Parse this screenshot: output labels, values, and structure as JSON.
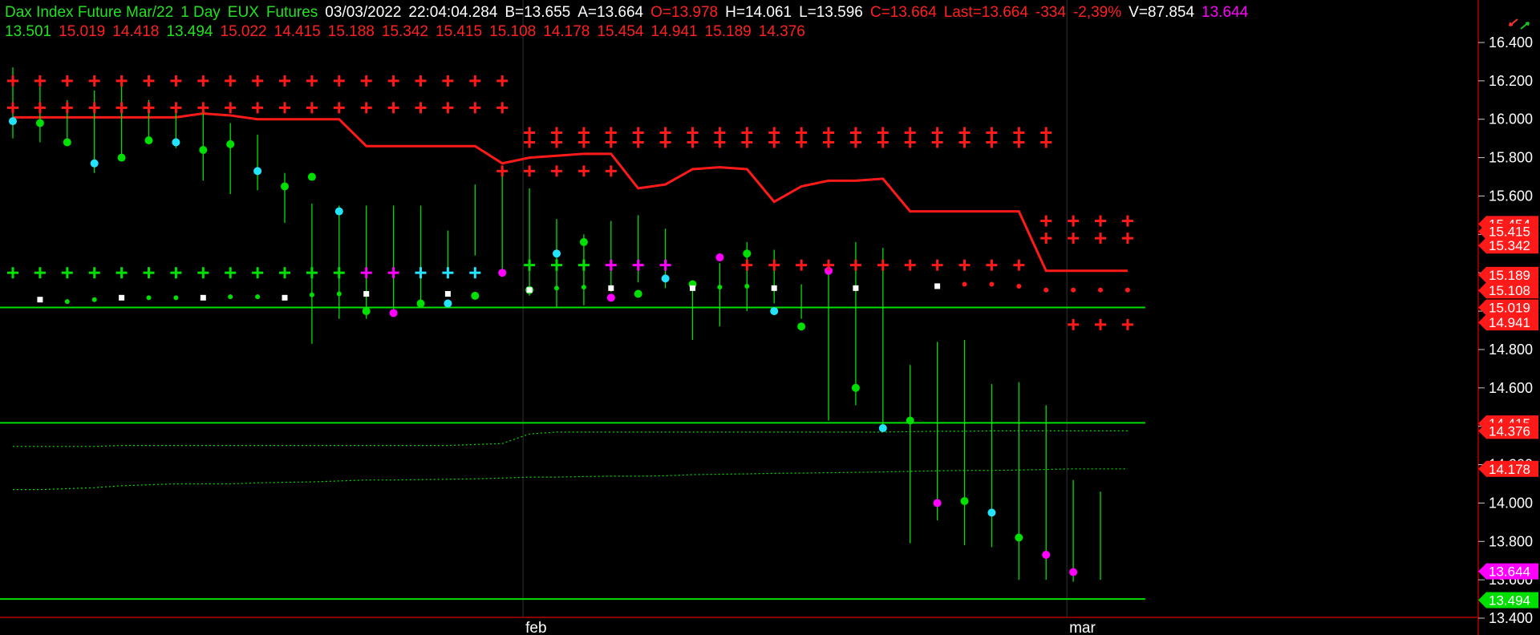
{
  "header": {
    "line1": [
      {
        "text": "Dax Index Future Mar/22",
        "color": "#22e022"
      },
      {
        "text": "1 Day",
        "color": "#22e022"
      },
      {
        "text": "EUX",
        "color": "#22e022"
      },
      {
        "text": "Futures",
        "color": "#22e022"
      },
      {
        "text": "03/03/2022",
        "color": "#ffffff"
      },
      {
        "text": "22:04:04.284",
        "color": "#ffffff"
      },
      {
        "text": "B=13.655",
        "color": "#ffffff"
      },
      {
        "text": "A=13.664",
        "color": "#ffffff"
      },
      {
        "text": "O=13.978",
        "color": "#ff2020"
      },
      {
        "text": "H=14.061",
        "color": "#ffffff"
      },
      {
        "text": "L=13.596",
        "color": "#ffffff"
      },
      {
        "text": "C=13.664",
        "color": "#ff2020"
      },
      {
        "text": "Last=13.664",
        "color": "#ff2020"
      },
      {
        "text": "-334",
        "color": "#ff2020"
      },
      {
        "text": "-2,39%",
        "color": "#ff2020"
      },
      {
        "text": "V=87.854",
        "color": "#ffffff"
      },
      {
        "text": "13.644",
        "color": "#ff00ff"
      }
    ],
    "line2": [
      {
        "text": "13.501",
        "color": "#22e022"
      },
      {
        "text": "15.019",
        "color": "#ff2020"
      },
      {
        "text": "14.418",
        "color": "#ff2020"
      },
      {
        "text": "13.494",
        "color": "#22e022"
      },
      {
        "text": "15.022",
        "color": "#ff2020"
      },
      {
        "text": "14.415",
        "color": "#ff2020"
      },
      {
        "text": "15.188",
        "color": "#ff2020"
      },
      {
        "text": "15.342",
        "color": "#ff2020"
      },
      {
        "text": "15.415",
        "color": "#ff2020"
      },
      {
        "text": "15.108",
        "color": "#ff2020"
      },
      {
        "text": "14.178",
        "color": "#ff2020"
      },
      {
        "text": "15.454",
        "color": "#ff2020"
      },
      {
        "text": "14.941",
        "color": "#ff2020"
      },
      {
        "text": "15.189",
        "color": "#ff2020"
      },
      {
        "text": "14.376",
        "color": "#ff2020"
      }
    ]
  },
  "colors": {
    "background": "#000000",
    "green": "#00e000",
    "red": "#ff1a1a",
    "cyan": "#22e4ff",
    "magenta": "#ff00ff",
    "white": "#ffffff",
    "axis": "#c8c8c8",
    "grid": "#333333"
  },
  "chart_data": {
    "type": "line",
    "title": "Dax Index Future Mar/22",
    "ylim": [
      13400,
      16500
    ],
    "y_ticks": [
      16400,
      16200,
      16000,
      15800,
      15600,
      15400,
      15200,
      15000,
      14800,
      14600,
      14400,
      14200,
      14000,
      13800,
      13600,
      13400
    ],
    "y_tick_labels": [
      "16.400",
      "16.200",
      "16.000",
      "15.800",
      "15.600",
      "15.400",
      "15.200",
      "15.000",
      "14.800",
      "14.600",
      "14.400",
      "14.200",
      "14.000",
      "13.800",
      "13.600",
      "13.400"
    ],
    "x_month_labels": [
      {
        "bar": 19,
        "label": "feb"
      },
      {
        "bar": 39,
        "label": "mar"
      }
    ],
    "grid": true,
    "price_bars": {
      "high": [
        16270,
        16170,
        16100,
        16150,
        16180,
        16100,
        16030,
        16030,
        15980,
        15920,
        15720,
        15560,
        15550,
        15550,
        15550,
        15550,
        15420,
        15660,
        15710,
        15640,
        15480,
        15400,
        15470,
        15500,
        15430,
        15130,
        15250,
        15360,
        15320,
        15140,
        15210,
        15360,
        15330,
        14720,
        14840,
        14850,
        14620,
        14630,
        14510,
        14120,
        14060
      ],
      "low": [
        15900,
        15880,
        15860,
        15720,
        15790,
        15900,
        15850,
        15680,
        15610,
        15630,
        15460,
        14830,
        14960,
        14960,
        15000,
        15030,
        15170,
        15290,
        15220,
        15080,
        15020,
        15030,
        15100,
        15150,
        15120,
        14850,
        14920,
        15000,
        15040,
        14960,
        14430,
        14510,
        14380,
        13790,
        13910,
        13780,
        13770,
        13600,
        13600,
        13590,
        13600
      ],
      "marker": [
        15990,
        15980,
        15880,
        15770,
        15800,
        15890,
        15880,
        15840,
        15870,
        15730,
        15650,
        15700,
        15520,
        15000,
        14990,
        15040,
        15040,
        15080,
        15200,
        15110,
        15300,
        15360,
        15070,
        15090,
        15170,
        15140,
        15280,
        15300,
        15000,
        14920,
        15210,
        14600,
        14390,
        14430,
        14000,
        14010,
        13950,
        13820,
        13730,
        13640
      ]
    },
    "series": [
      {
        "name": "13.501",
        "color": "#00e000",
        "style": "flat",
        "values": [
          {
            "from": 0,
            "to": 42,
            "y": 13500
          }
        ]
      },
      {
        "name": "14.418",
        "color": "#00e000",
        "style": "flat",
        "values": [
          {
            "from": 0,
            "to": 42,
            "y": 14418
          }
        ]
      },
      {
        "name": "15.019",
        "color": "#00e000",
        "style": "flat",
        "values": [
          {
            "from": 0,
            "to": 42,
            "y": 15019
          }
        ]
      },
      {
        "name": "14.376",
        "color": "#00e000",
        "style": "dotted",
        "values": [
          14295,
          14295,
          14295,
          14295,
          14300,
          14300,
          14300,
          14300,
          14300,
          14300,
          14300,
          14300,
          14300,
          14300,
          14300,
          14300,
          14300,
          14305,
          14310,
          14360,
          14370,
          14370,
          14370,
          14370,
          14370,
          14370,
          14370,
          14370,
          14370,
          14370,
          14370,
          14370,
          14370,
          14372,
          14374,
          14374,
          14376,
          14376,
          14376,
          14376,
          14376,
          14376
        ]
      },
      {
        "name": "14.178",
        "color": "#00e000",
        "style": "dotted",
        "values": [
          14070,
          14070,
          14075,
          14080,
          14090,
          14095,
          14100,
          14100,
          14100,
          14105,
          14108,
          14110,
          14115,
          14120,
          14120,
          14122,
          14124,
          14126,
          14130,
          14135,
          14135,
          14138,
          14140,
          14140,
          14142,
          14148,
          14150,
          14152,
          14155,
          14156,
          14158,
          14160,
          14162,
          14165,
          14168,
          14170,
          14170,
          14172,
          14175,
          14178,
          14178,
          14178
        ]
      },
      {
        "name": "stop",
        "color": "#ff1a1a",
        "style": "line",
        "values": [
          16010,
          16010,
          16010,
          16010,
          16010,
          16010,
          16010,
          16030,
          16020,
          16000,
          16000,
          16000,
          16000,
          15860,
          15860,
          15860,
          15860,
          15860,
          15770,
          15800,
          15810,
          15820,
          15820,
          15640,
          15660,
          15740,
          15750,
          15740,
          15570,
          15650,
          15680,
          15680,
          15690,
          15520,
          15520,
          15520,
          15520,
          15520,
          15210,
          15210,
          15210,
          15210
        ]
      },
      {
        "name": "white dots",
        "color": "#ffffff",
        "style": "points",
        "values": [
          {
            "bar": 1,
            "y": 15060
          },
          {
            "bar": 4,
            "y": 15070
          },
          {
            "bar": 7,
            "y": 15070
          },
          {
            "bar": 10,
            "y": 15070
          },
          {
            "bar": 13,
            "y": 15090
          },
          {
            "bar": 16,
            "y": 15090
          },
          {
            "bar": 19,
            "y": 15110
          },
          {
            "bar": 22,
            "y": 15120
          },
          {
            "bar": 25,
            "y": 15120
          },
          {
            "bar": 28,
            "y": 15120
          },
          {
            "bar": 31,
            "y": 15120
          },
          {
            "bar": 34,
            "y": 15130
          }
        ]
      },
      {
        "name": "green dots",
        "color": "#00e000",
        "style": "points",
        "values": [
          {
            "bar": 2,
            "y": 15050
          },
          {
            "bar": 3,
            "y": 15060
          },
          {
            "bar": 5,
            "y": 15070
          },
          {
            "bar": 6,
            "y": 15070
          },
          {
            "bar": 8,
            "y": 15075
          },
          {
            "bar": 9,
            "y": 15075
          },
          {
            "bar": 11,
            "y": 15085
          },
          {
            "bar": 12,
            "y": 15090
          },
          {
            "bar": 20,
            "y": 15120
          },
          {
            "bar": 21,
            "y": 15125
          },
          {
            "bar": 26,
            "y": 15125
          },
          {
            "bar": 27,
            "y": 15130
          }
        ]
      },
      {
        "name": "red dots",
        "color": "#ff1a1a",
        "style": "points",
        "values": [
          {
            "bar": 35,
            "y": 15140
          },
          {
            "bar": 36,
            "y": 15140
          },
          {
            "bar": 37,
            "y": 15130
          },
          {
            "bar": 38,
            "y": 15110
          },
          {
            "bar": 39,
            "y": 15110
          },
          {
            "bar": 40,
            "y": 15110
          },
          {
            "bar": 41,
            "y": 15110
          }
        ]
      }
    ],
    "cross_rows": [
      {
        "color": "#ff1a1a",
        "y": 16200,
        "from": 0,
        "to": 18
      },
      {
        "color": "#ff1a1a",
        "y": 16060,
        "from": 0,
        "to": 18
      },
      {
        "color": "#ff1a1a",
        "y": 15930,
        "from": 19,
        "to": 38
      },
      {
        "color": "#ff1a1a",
        "y": 15880,
        "from": 19,
        "to": 38
      },
      {
        "color": "#ff1a1a",
        "y": 15730,
        "from": 18,
        "to": 22
      },
      {
        "color": "#ff1a1a",
        "y": 15470,
        "from": 38,
        "to": 41
      },
      {
        "color": "#ff1a1a",
        "y": 15380,
        "from": 38,
        "to": 41
      },
      {
        "color": "#ff1a1a",
        "y": 14930,
        "from": 39,
        "to": 41
      },
      {
        "color": "#00e000",
        "y": 15200,
        "from": 0,
        "to": 12
      },
      {
        "color": "#00e000",
        "y": 15240,
        "from": 19,
        "to": 21
      },
      {
        "color": "#ff00ff",
        "y": 15200,
        "from": 13,
        "to": 14
      },
      {
        "color": "#22e4ff",
        "y": 15200,
        "from": 15,
        "to": 17
      },
      {
        "color": "#ff00ff",
        "y": 15240,
        "from": 22,
        "to": 24
      },
      {
        "color": "#ff1a1a",
        "y": 15240,
        "from": 27,
        "to": 37
      }
    ],
    "right_labels": [
      {
        "text": "15.454",
        "y": 15454,
        "color": "#ff1a1a"
      },
      {
        "text": "15.415",
        "y": 15415,
        "color": "#ff1a1a"
      },
      {
        "text": "15.342",
        "y": 15342,
        "color": "#ff1a1a"
      },
      {
        "text": "15.189",
        "y": 15189,
        "color": "#ff1a1a"
      },
      {
        "text": "15.108",
        "y": 15108,
        "color": "#ff1a1a"
      },
      {
        "text": "15.019",
        "y": 15019,
        "color": "#ff1a1a"
      },
      {
        "text": "14.941",
        "y": 14941,
        "color": "#ff1a1a"
      },
      {
        "text": "14.415",
        "y": 14415,
        "color": "#ff1a1a"
      },
      {
        "text": "14.376",
        "y": 14376,
        "color": "#ff1a1a"
      },
      {
        "text": "14.178",
        "y": 14178,
        "color": "#ff1a1a"
      },
      {
        "text": "13.644",
        "y": 13644,
        "color": "#ff00ff"
      },
      {
        "text": "13.494",
        "y": 13494,
        "color": "#00e000"
      }
    ]
  }
}
